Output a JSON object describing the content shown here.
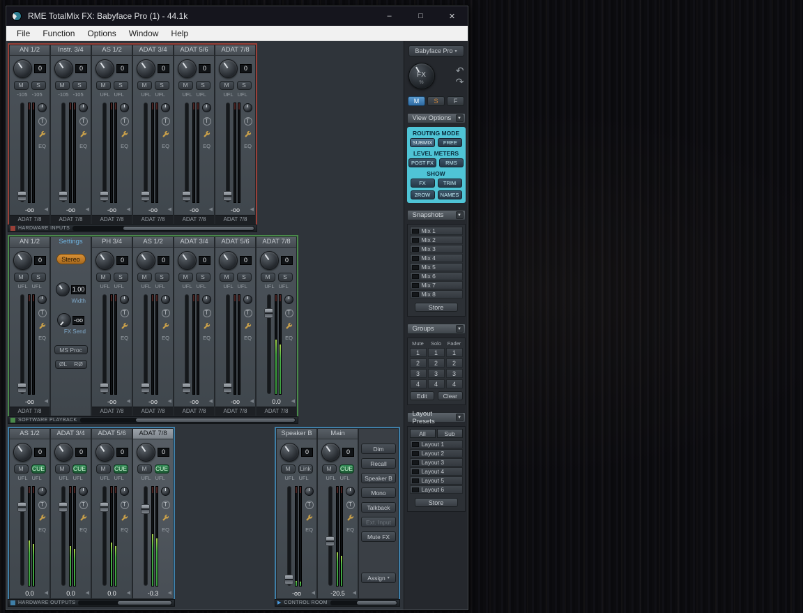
{
  "window": {
    "title": "RME TotalMix FX: Babyface Pro (1) - 44.1k",
    "minimize": "–",
    "maximize": "□",
    "close": "✕"
  },
  "menu": [
    "File",
    "Function",
    "Options",
    "Window",
    "Help"
  ],
  "glyphs": {
    "dropdown": "▾",
    "panel_arrow": "▼",
    "collapse": "◀",
    "undo": "↶",
    "redo": "↷",
    "play": "▶"
  },
  "labels": {
    "trim": "T",
    "eq": "EQ"
  },
  "rows": {
    "hardware_inputs": {
      "label": "HARDWARE INPUTS",
      "channels": [
        {
          "name": "AN 1/2",
          "gain": "0",
          "m": "M",
          "s": "S",
          "levels": "-105   -105",
          "value": "-oo",
          "assign": "ADAT 7/8",
          "fader_pos": "2%"
        },
        {
          "name": "Instr. 3/4",
          "gain": "0",
          "m": "M",
          "s": "S",
          "levels": "-105   -105",
          "value": "-oo",
          "assign": "ADAT 7/8",
          "fader_pos": "2%"
        },
        {
          "name": "AS 1/2",
          "gain": "0",
          "m": "M",
          "s": "S",
          "levels": "UFL   UFL",
          "value": "-oo",
          "assign": "ADAT 7/8",
          "fader_pos": "2%"
        },
        {
          "name": "ADAT 3/4",
          "gain": "0",
          "m": "M",
          "s": "S",
          "levels": "UFL   UFL",
          "value": "-oo",
          "assign": "ADAT 7/8",
          "fader_pos": "2%"
        },
        {
          "name": "ADAT 5/6",
          "gain": "0",
          "m": "M",
          "s": "S",
          "levels": "UFL   UFL",
          "value": "-oo",
          "assign": "ADAT 7/8",
          "fader_pos": "2%"
        },
        {
          "name": "ADAT 7/8",
          "gain": "0",
          "m": "M",
          "s": "S",
          "levels": "UFL   UFL",
          "value": "-oo",
          "assign": "ADAT 7/8",
          "fader_pos": "2%"
        }
      ]
    },
    "software_playback": {
      "label": "SOFTWARE PLAYBACK",
      "channels_left": [
        {
          "name": "AN 1/2",
          "gain": "0",
          "m": "M",
          "s": "S",
          "levels": "UFL   UFL",
          "value": "-oo",
          "assign": "ADAT 7/8",
          "fader_pos": "2%"
        }
      ],
      "channels_right": [
        {
          "name": "PH 3/4",
          "gain": "0",
          "m": "M",
          "s": "S",
          "levels": "UFL   UFL",
          "value": "-oo",
          "assign": "ADAT 7/8",
          "fader_pos": "2%"
        },
        {
          "name": "AS 1/2",
          "gain": "0",
          "m": "M",
          "s": "S",
          "levels": "UFL   UFL",
          "value": "-oo",
          "assign": "ADAT 7/8",
          "fader_pos": "2%"
        },
        {
          "name": "ADAT 3/4",
          "gain": "0",
          "m": "M",
          "s": "S",
          "levels": "UFL   UFL",
          "value": "-oo",
          "assign": "ADAT 7/8",
          "fader_pos": "2%"
        },
        {
          "name": "ADAT 5/6",
          "gain": "0",
          "m": "M",
          "s": "S",
          "levels": "UFL   UFL",
          "value": "-oo",
          "assign": "ADAT 7/8",
          "fader_pos": "2%"
        },
        {
          "name": "ADAT 7/8",
          "gain": "0",
          "m": "M",
          "s": "S",
          "levels": "UFL   UFL",
          "value": "0.0",
          "assign": "ADAT 7/8",
          "fader_pos": "76%",
          "meter": "55%",
          "meter2": "50%"
        }
      ]
    },
    "hardware_outputs": {
      "label": "HARDWARE OUTPUTS",
      "channels": [
        {
          "name": "AS 1/2",
          "gain": "0",
          "m": "M",
          "s": "CUE",
          "cue": true,
          "levels": "UFL   UFL",
          "value": "0.0",
          "fader_pos": "74%",
          "meter": "46%",
          "meter2": "42%"
        },
        {
          "name": "ADAT 3/4",
          "gain": "0",
          "m": "M",
          "s": "CUE",
          "cue": true,
          "levels": "UFL   UFL",
          "value": "0.0",
          "fader_pos": "74%",
          "meter": "40%",
          "meter2": "37%"
        },
        {
          "name": "ADAT 5/6",
          "gain": "0",
          "m": "M",
          "s": "CUE",
          "cue": true,
          "levels": "UFL   UFL",
          "value": "0.0",
          "fader_pos": "74%",
          "meter": "44%",
          "meter2": "40%"
        },
        {
          "name": "ADAT 7/8",
          "gain": "0",
          "m": "M",
          "s": "CUE",
          "cue": true,
          "selected": true,
          "levels": "UFL   UFL",
          "value": "-0.3",
          "fader_pos": "72%",
          "meter": "52%",
          "meter2": "48%"
        }
      ]
    }
  },
  "settings_panel": {
    "title": "Settings",
    "stereo": "Stereo",
    "width_value": "1.00",
    "width_label": "Width",
    "fx_value": "-oo",
    "fx_label": "FX Send",
    "ms_proc": "MS Proc",
    "phase_l": "ØL",
    "phase_r": "RØ"
  },
  "control_room": {
    "label": "CONTROL ROOM",
    "channels": [
      {
        "name": "Speaker B",
        "gain": "0",
        "m": "M",
        "s": "Link",
        "levels": "UFL   UFL",
        "value": "-oo",
        "fader_pos": "2%",
        "meter": "5%",
        "meter2": "4%"
      },
      {
        "name": "Main",
        "gain": "0",
        "m": "M",
        "s": "CUE",
        "cue": true,
        "levels": "UFL   UFL",
        "value": "-20.5",
        "fader_pos": "40%",
        "meter": "34%",
        "meter2": "30%"
      }
    ],
    "buttons": [
      {
        "label": "Dim"
      },
      {
        "label": "Recall"
      },
      {
        "label": "Speaker B"
      },
      {
        "label": "Mono"
      },
      {
        "label": "Talkback",
        "gap": true
      },
      {
        "label": "Ext. Input",
        "disabled": true
      },
      {
        "label": "Mute FX"
      }
    ],
    "assign": "Assign"
  },
  "sidebar": {
    "device": "Babyface Pro",
    "fx_label": "FX",
    "fx_unit": "%",
    "msf": [
      {
        "label": "M",
        "cls": "msf-m"
      },
      {
        "label": "S",
        "cls": "msf-s"
      },
      {
        "label": "F",
        "cls": "msf-f"
      }
    ],
    "view_options": {
      "title": "View Options",
      "routing_mode": "ROUTING MODE",
      "routing_buttons": [
        {
          "label": "SUBMIX",
          "active": true
        },
        {
          "label": "FREE"
        }
      ],
      "level_meters": "LEVEL METERS",
      "meter_buttons": [
        {
          "label": "POST FX"
        },
        {
          "label": "RMS"
        }
      ],
      "show": "SHOW",
      "show_buttons": [
        {
          "label": "FX"
        },
        {
          "label": "TRIM"
        }
      ],
      "show_buttons2": [
        {
          "label": "2ROW"
        },
        {
          "label": "NAMES"
        }
      ]
    },
    "snapshots": {
      "title": "Snapshots",
      "items": [
        "Mix 1",
        "Mix 2",
        "Mix 3",
        "Mix 4",
        "Mix 5",
        "Mix 6",
        "Mix 7",
        "Mix 8"
      ],
      "store": "Store"
    },
    "groups": {
      "title": "Groups",
      "headers": [
        "Mute",
        "Solo",
        "Fader"
      ],
      "rows": [
        [
          "1",
          "1",
          "1"
        ],
        [
          "2",
          "2",
          "2"
        ],
        [
          "3",
          "3",
          "3"
        ],
        [
          "4",
          "4",
          "4"
        ]
      ],
      "edit": "Edit",
      "clear": "Clear"
    },
    "layout_presets": {
      "title": "Layout Presets",
      "all": "All",
      "sub": "Sub",
      "items": [
        "Layout 1",
        "Layout 2",
        "Layout 3",
        "Layout 4",
        "Layout 5",
        "Layout 6"
      ],
      "store": "Store"
    }
  }
}
